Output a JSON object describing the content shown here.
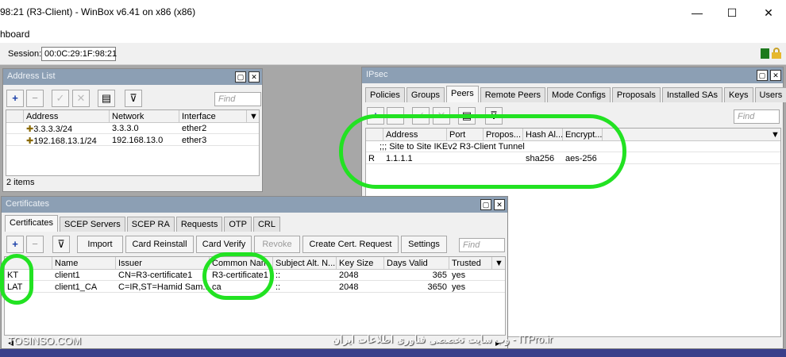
{
  "window": {
    "title": "98:21 (R3-Client) - WinBox v6.41 on x86 (x86)",
    "menu": "hboard",
    "min": "—",
    "max": "☐",
    "close": "✕"
  },
  "session": {
    "label": "Session:",
    "value": "00:0C:29:1F:98:21"
  },
  "address_list": {
    "title": "Address List",
    "find": "Find",
    "columns": [
      "Address",
      "Network",
      "Interface"
    ],
    "rows": [
      {
        "address": "3.3.3.3/24",
        "network": "3.3.3.0",
        "interface": "ether2"
      },
      {
        "address": "192.168.13.1/24",
        "network": "192.168.13.0",
        "interface": "ether3"
      }
    ],
    "status": "2 items"
  },
  "ipsec": {
    "title": "IPsec",
    "tabs": [
      "Policies",
      "Groups",
      "Peers",
      "Remote Peers",
      "Mode Configs",
      "Proposals",
      "Installed SAs",
      "Keys",
      "Users"
    ],
    "find": "Find",
    "columns": [
      "Address",
      "Port",
      "Propos...",
      "Hash Al...",
      "Encrypt..."
    ],
    "comment": ";;; Site to Site IKEv2 R3-Client Tunnel",
    "row": {
      "flag": "R",
      "address": "1.1.1.1",
      "port": "",
      "proposal": "",
      "hash": "sha256",
      "encryption": "aes-256"
    }
  },
  "certs": {
    "title": "Certificates",
    "tabs": [
      "Certificates",
      "SCEP Servers",
      "SCEP RA",
      "Requests",
      "OTP",
      "CRL"
    ],
    "buttons": [
      "Import",
      "Card Reinstall",
      "Card Verify",
      "Revoke",
      "Create Cert. Request",
      "Settings"
    ],
    "find": "Find",
    "columns": [
      "Name",
      "Issuer",
      "Common Nam",
      "Subject Alt. N...",
      "Key Size",
      "Days Valid",
      "Trusted"
    ],
    "rows": [
      {
        "flag": "KT",
        "name": "client1",
        "issuer": "CN=R3-certificate1",
        "common": "R3-certificate1",
        "san": "::",
        "keysize": "2048",
        "days": "365",
        "trusted": "yes"
      },
      {
        "flag": "LAT",
        "name": "client1_CA",
        "issuer": "C=IR,ST=Hamid Sam...",
        "common": "ca",
        "san": "::",
        "keysize": "2048",
        "days": "3650",
        "trusted": "yes"
      }
    ]
  },
  "watermark": {
    "left": "TOSINSO.COM",
    "right": "ITPro.ir - وب سایت تخصصی فناوری اطلاعات ایران"
  }
}
